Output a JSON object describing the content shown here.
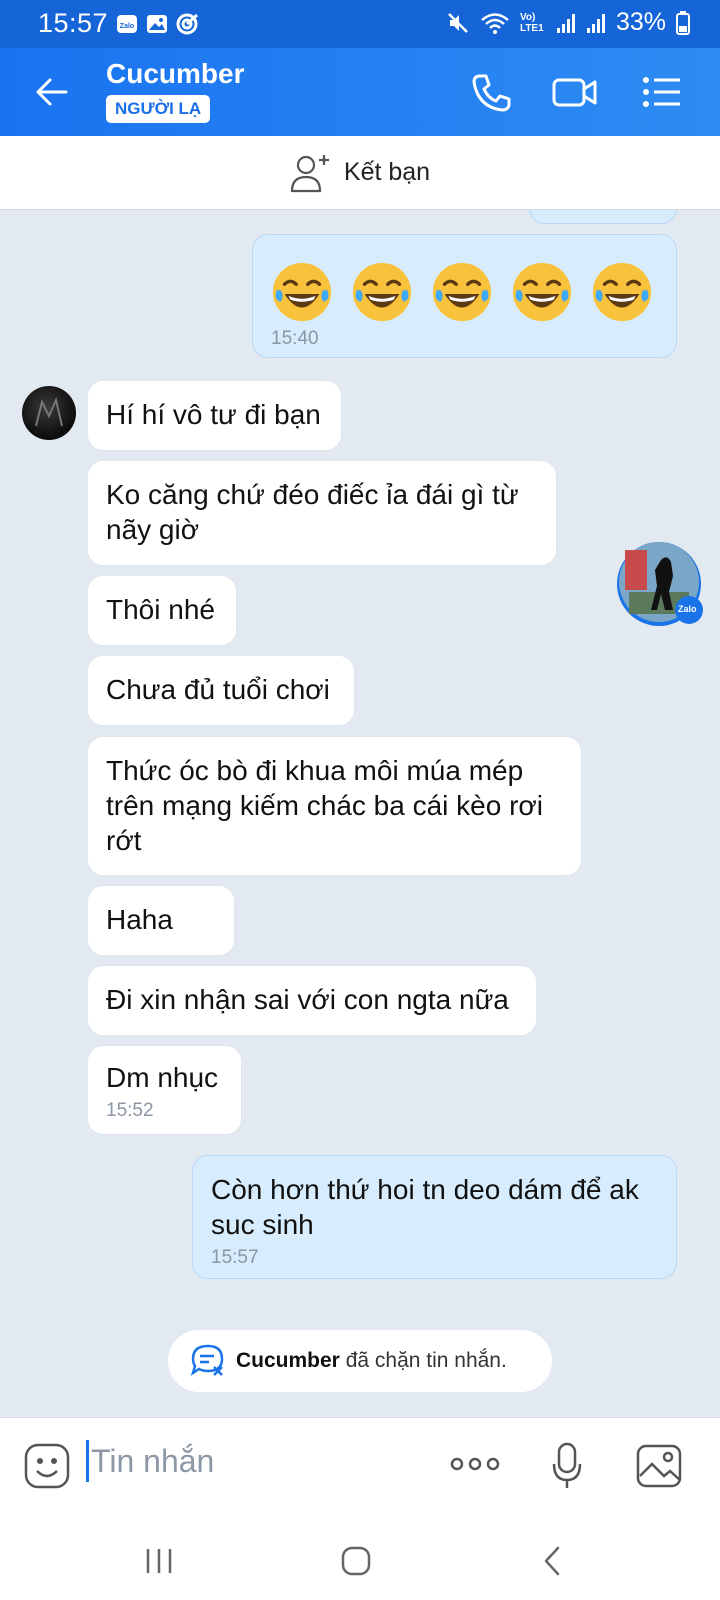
{
  "status_bar": {
    "time": "15:57",
    "battery": "33%",
    "network_label": "Vo) LTE1"
  },
  "header": {
    "contact_name": "Cucumber",
    "badge": "NGƯỜI LẠ",
    "icons": [
      "back-arrow-icon",
      "phone-icon",
      "video-call-icon",
      "menu-list-icon"
    ]
  },
  "add_friend": {
    "label": "Kết bạn"
  },
  "messages": [
    {
      "side": "out",
      "emoji_count": 5,
      "time": "15:40"
    },
    {
      "side": "in",
      "text": "Hí hí vô tư đi bạn"
    },
    {
      "side": "in",
      "text": "Ko căng chứ đéo điếc ỉa đái gì từ nãy giờ"
    },
    {
      "side": "in",
      "text": "Thôi nhé"
    },
    {
      "side": "in",
      "text": "Chưa đủ tuổi chơi"
    },
    {
      "side": "in",
      "text": "Thức óc bò đi khua môi múa mép trên mạng kiếm chác ba cái kèo rơi rớt"
    },
    {
      "side": "in",
      "text": "Haha"
    },
    {
      "side": "in",
      "text": "Đi xin nhận sai với con ngta nữa"
    },
    {
      "side": "in",
      "text": "Dm nhục",
      "time": "15:52"
    },
    {
      "side": "out",
      "text": "Còn hơn thứ hoi tn deo dám để ak suc sinh",
      "time": "15:57"
    }
  ],
  "blocked_notice": {
    "name": "Cucumber",
    "text": " đã chặn tin nhắn."
  },
  "input": {
    "placeholder": "Tin nhắn"
  },
  "floating_bubble": {
    "label": "Zalo"
  },
  "colors": {
    "header": "#1a73f0",
    "outgoing_bubble": "#d7ecfd",
    "incoming_bubble": "#ffffff",
    "background": "#e2e9f1"
  }
}
